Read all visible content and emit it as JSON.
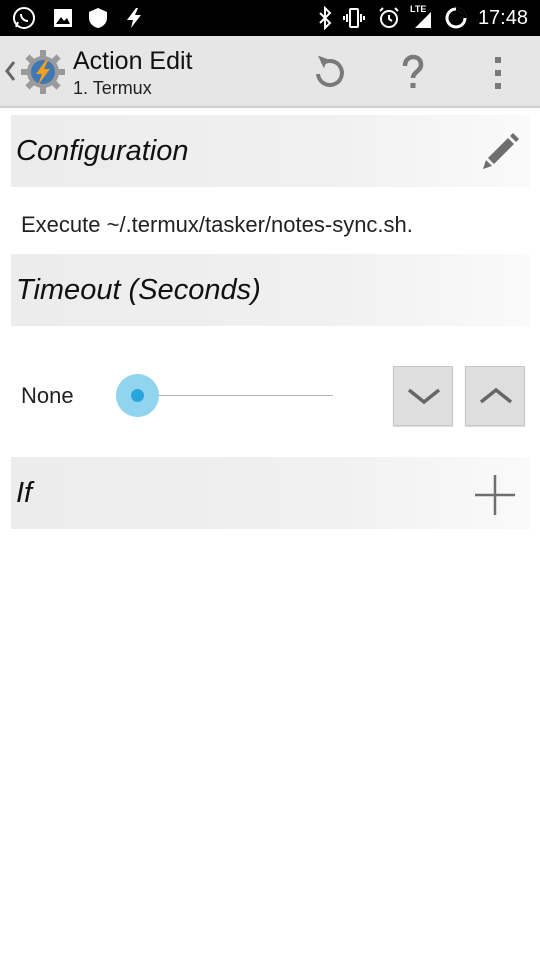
{
  "status_bar": {
    "time": "17:48",
    "network_label": "LTE",
    "left_icons": [
      "whatsapp-icon",
      "image-icon",
      "shield-icon",
      "flash-icon"
    ],
    "right_icons": [
      "bluetooth-icon",
      "vibrate-icon",
      "alarm-icon",
      "signal-icon",
      "battery-icon"
    ]
  },
  "action_bar": {
    "title": "Action Edit",
    "subtitle": "1. Termux",
    "buttons": [
      "reset-icon",
      "help-icon",
      "overflow-menu-icon"
    ]
  },
  "configuration": {
    "header": "Configuration",
    "description": "Execute ~/.termux/tasker/notes-sync.sh."
  },
  "timeout": {
    "header": "Timeout (Seconds)",
    "value_label": "None",
    "slider_level": 0
  },
  "condition": {
    "header": "If"
  },
  "colors": {
    "accent": "#28a5dc",
    "accent_halo": "#90d4ef",
    "actionbar_bg": "#e6e6e6",
    "section_bg": "#ececec"
  }
}
